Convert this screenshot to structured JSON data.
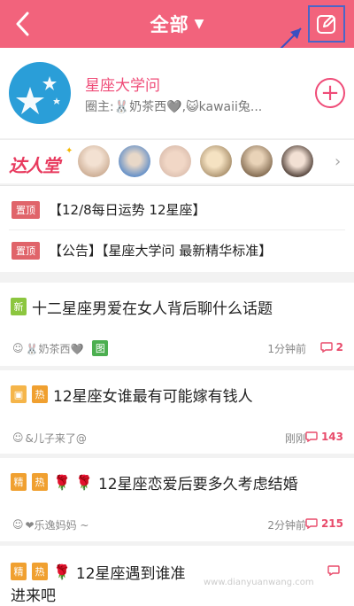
{
  "header": {
    "title": "全部",
    "title_caret": "▼",
    "back_icon": "chevron-left-icon",
    "edit_icon": "edit-pen-icon",
    "background": "#f2637c"
  },
  "circle": {
    "name": "星座大学问",
    "owner_text": "圈主:🐰奶茶西🩶,😺kawaii兔...",
    "join_label": "+",
    "accent": "#ef4c78"
  },
  "experts": {
    "label": "达人堂",
    "star": "✦",
    "more": "›"
  },
  "pinned": [
    {
      "badge": "置顶",
      "text": "【12/8每日运势 12星座】"
    },
    {
      "badge": "置顶",
      "text": "【公告】【星座大学问 最新精华标准】"
    }
  ],
  "posts": [
    {
      "badges": [
        "新"
      ],
      "title": "十二星座男爱在女人背后聊什么话题",
      "author": "🐰奶茶西🩶",
      "tag": "图",
      "time": "1分钟前",
      "comments": "2"
    },
    {
      "badges": [
        "热"
      ],
      "title": "12星座女谁最有可能嫁有钱人",
      "author": "&儿子来了@",
      "time": "刚刚",
      "comments": "143"
    },
    {
      "badges": [
        "精",
        "热"
      ],
      "roses": "🌹 🌹",
      "title": "12星座恋爱后要多久考虑结婚",
      "author": "❤乐逸妈妈 ~",
      "time": "2分钟前",
      "comments": "215"
    },
    {
      "badges": [
        "精",
        "热"
      ],
      "roses": "🌹",
      "title": "12星座遇到谁准",
      "title_line2": "进来吧",
      "comments": ""
    }
  ],
  "watermark": "www.dianyuanwang.com"
}
